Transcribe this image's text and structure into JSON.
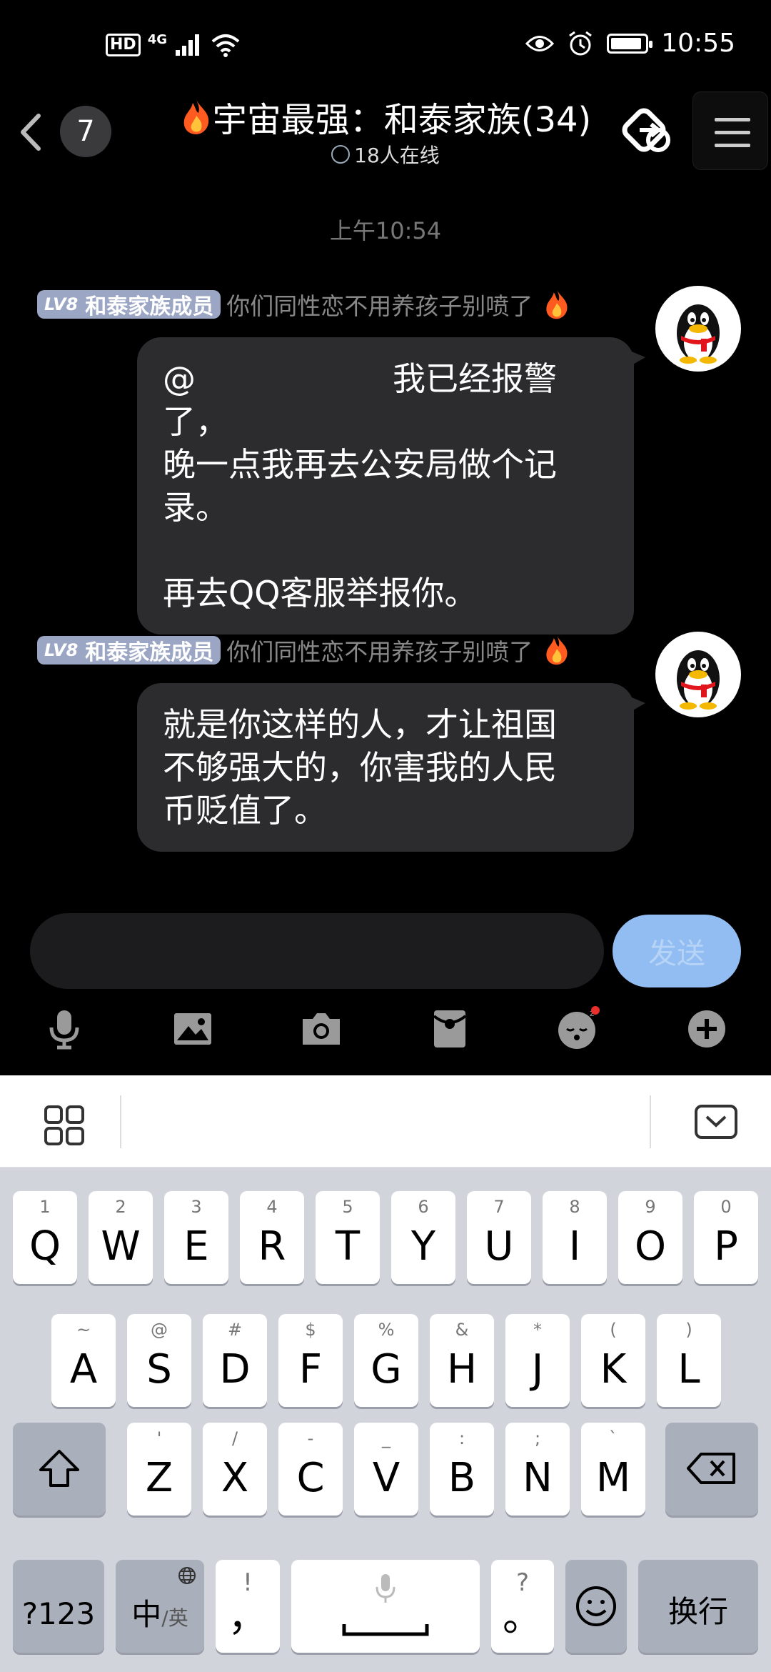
{
  "status_bar": {
    "hd": "HD",
    "network": "4G",
    "time": "10:55",
    "battery_level": 0.9,
    "icons": [
      "signal-icon",
      "wifi-icon",
      "eye-icon",
      "alarm-icon",
      "battery-icon"
    ]
  },
  "header": {
    "unread_count": "7",
    "title": "宇宙最强：和泰家族(34)",
    "online": "18人在线"
  },
  "chat": {
    "timestamp": "上午10:54",
    "messages": [
      {
        "level": "LV8",
        "role": "和泰家族成员",
        "note": "你们同性恋不用养孩子别喷了",
        "text": "@　　　　　　我已经报警了，\n晚一点我再去公安局做个记\n录。\n\n再去QQ客服举报你。"
      },
      {
        "level": "LV8",
        "role": "和泰家族成员",
        "note": "你们同性恋不用养孩子别喷了",
        "text": "就是你这样的人，才让祖国\n不够强大的，你害我的人民\n币贬值了。"
      }
    ]
  },
  "composer": {
    "send_label": "发送",
    "send_color": "#92bdf2"
  },
  "keyboard": {
    "row1": [
      {
        "hint": "1",
        "key": "Q"
      },
      {
        "hint": "2",
        "key": "W"
      },
      {
        "hint": "3",
        "key": "E"
      },
      {
        "hint": "4",
        "key": "R"
      },
      {
        "hint": "5",
        "key": "T"
      },
      {
        "hint": "6",
        "key": "Y"
      },
      {
        "hint": "7",
        "key": "U"
      },
      {
        "hint": "8",
        "key": "I"
      },
      {
        "hint": "9",
        "key": "O"
      },
      {
        "hint": "0",
        "key": "P"
      }
    ],
    "row2": [
      {
        "hint": "~",
        "key": "A"
      },
      {
        "hint": "@",
        "key": "S"
      },
      {
        "hint": "#",
        "key": "D"
      },
      {
        "hint": "$",
        "key": "F"
      },
      {
        "hint": "%",
        "key": "G"
      },
      {
        "hint": "&",
        "key": "H"
      },
      {
        "hint": "*",
        "key": "J"
      },
      {
        "hint": "(",
        "key": "K"
      },
      {
        "hint": ")",
        "key": "L"
      }
    ],
    "row3": [
      {
        "hint": "'",
        "key": "Z"
      },
      {
        "hint": "/",
        "key": "X"
      },
      {
        "hint": "-",
        "key": "C"
      },
      {
        "hint": "_",
        "key": "V"
      },
      {
        "hint": ":",
        "key": "B"
      },
      {
        "hint": ";",
        "key": "N"
      },
      {
        "hint": "`",
        "key": "M"
      }
    ],
    "numbers_label": "?123",
    "lang_label": "中",
    "lang_sub": "/英",
    "comma_hint": "!",
    "comma_key": "，",
    "period_hint": "?",
    "period_key": "。",
    "enter_label": "换行"
  }
}
